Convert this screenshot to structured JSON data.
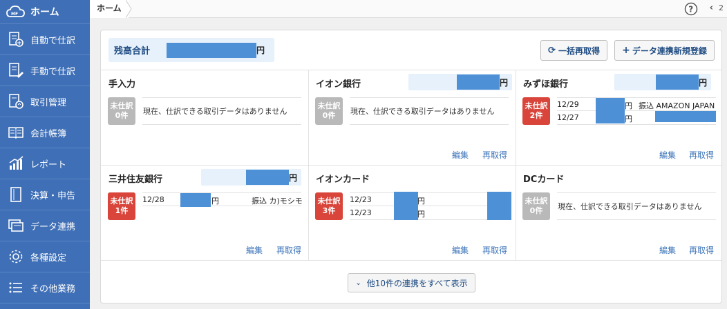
{
  "sidebar": {
    "logo_label": "ホーム",
    "items": [
      {
        "label": "自動で仕訳",
        "icon": "auto-journal-icon"
      },
      {
        "label": "手動で仕訳",
        "icon": "manual-journal-icon"
      },
      {
        "label": "取引管理",
        "icon": "transaction-icon"
      },
      {
        "label": "会計帳簿",
        "icon": "ledger-icon"
      },
      {
        "label": "レポート",
        "icon": "report-icon"
      },
      {
        "label": "決算・申告",
        "icon": "settlement-icon"
      },
      {
        "label": "データ連携",
        "icon": "data-link-icon"
      },
      {
        "label": "各種設定",
        "icon": "gear-icon"
      },
      {
        "label": "その他業務",
        "icon": "list-icon"
      }
    ]
  },
  "topbar": {
    "breadcrumb": "ホーム",
    "nav_text": "2"
  },
  "summary": {
    "total_label": "残高合計",
    "yen": "円",
    "refresh_all_button": "一括再取得",
    "new_link_button": "データ連携新規登録"
  },
  "cards": [
    {
      "title": "手入力",
      "badge_line1": "未仕訳",
      "badge_line2": "0件",
      "empty_msg": "現在、仕訳できる取引データはありません",
      "edit": "",
      "refetch": ""
    },
    {
      "title": "イオン銀行",
      "yen": "円",
      "badge_line1": "未仕訳",
      "badge_line2": "0件",
      "empty_msg": "現在、仕訳できる取引データはありません",
      "edit": "編集",
      "refetch": "再取得"
    },
    {
      "title": "みずほ銀行",
      "yen": "円",
      "badge_line1": "未仕訳",
      "badge_line2": "2件",
      "transactions": [
        {
          "date": "12/29",
          "yen": "円",
          "desc": "振込 AMAZON JAPAN"
        },
        {
          "date": "12/27",
          "yen": "円",
          "desc": ""
        }
      ],
      "edit": "編集",
      "refetch": "再取得"
    },
    {
      "title": "三井住友銀行",
      "yen": "円",
      "badge_line1": "未仕訳",
      "badge_line2": "1件",
      "transactions": [
        {
          "date": "12/28",
          "yen": "円",
          "desc": "振込 カ)モシモ"
        }
      ],
      "edit": "編集",
      "refetch": "再取得"
    },
    {
      "title": "イオンカード",
      "badge_line1": "未仕訳",
      "badge_line2": "3件",
      "transactions": [
        {
          "date": "12/23",
          "yen": "円",
          "desc": ""
        },
        {
          "date": "12/23",
          "yen": "円",
          "desc": ""
        }
      ],
      "edit": "編集",
      "refetch": "再取得"
    },
    {
      "title": "DCカード",
      "badge_line1": "未仕訳",
      "badge_line2": "0件",
      "empty_msg": "現在、仕訳できる取引データはありません",
      "edit": "編集",
      "refetch": "再取得"
    }
  ],
  "show_more": "他10件の連携をすべて表示",
  "colors": {
    "sidebar": "#3f6fb6",
    "accent": "#1e4b82",
    "badge_red": "#d9453a",
    "badge_gray": "#b9b9b9",
    "redaction": "#4d90d6"
  }
}
